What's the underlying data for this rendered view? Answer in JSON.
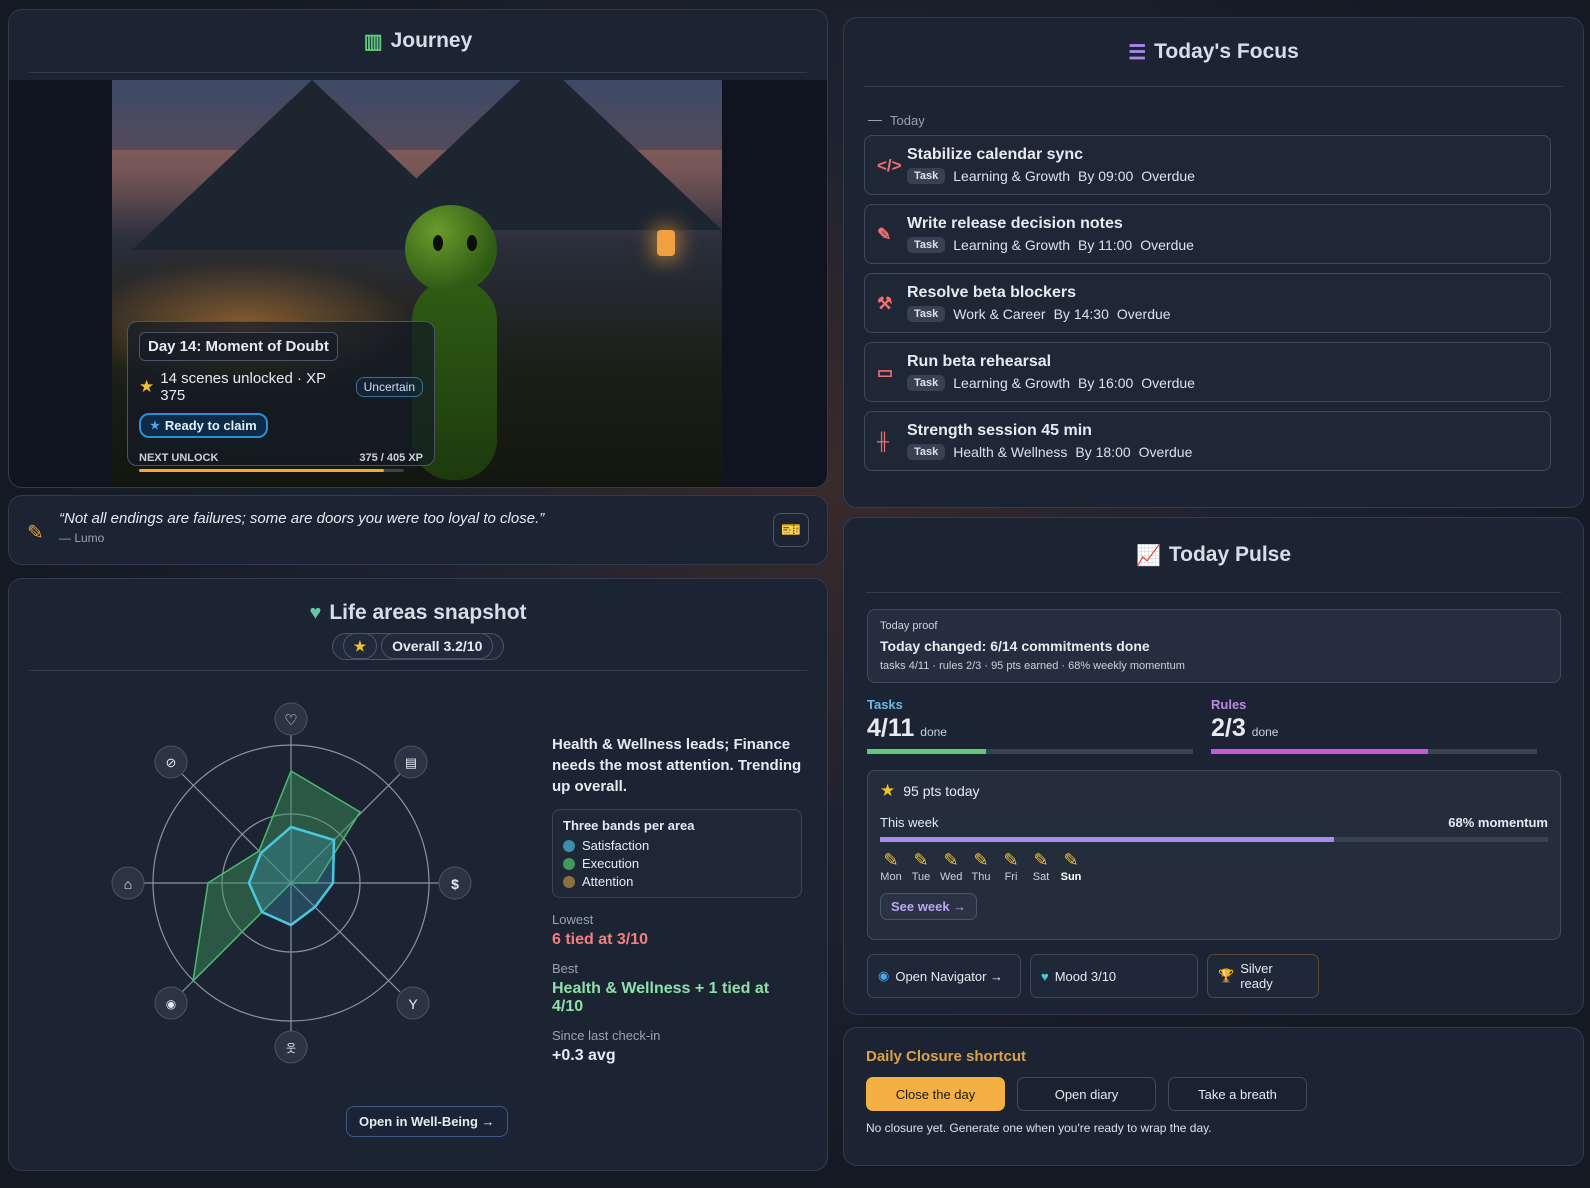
{
  "journey": {
    "title": "Journey",
    "day_title": "Day 14: Moment of Doubt",
    "scenes_text": "14 scenes unlocked · XP 375",
    "mood_badge": "Uncertain",
    "claim_label": "Ready to claim",
    "next_unlock_label": "NEXT UNLOCK",
    "xp_progress": "375 / 405 XP",
    "xp_current": 375,
    "xp_target": 405
  },
  "quote": {
    "text": "“Not all endings are failures; some are doors you were too loyal to close.”",
    "author": "— Lumo"
  },
  "life": {
    "title": "Life areas snapshot",
    "overall": "Overall 3.2/10",
    "lead_text": "Health & Wellness leads; Finance needs the most attention. Trending up overall.",
    "bands_title": "Three bands per area",
    "bands": [
      "Satisfaction",
      "Execution",
      "Attention"
    ],
    "band_colors": [
      "#3a8fa8",
      "#3f9a5c",
      "#8a7040"
    ],
    "lowest_label": "Lowest",
    "lowest_value": "6 tied at 3/10",
    "best_label": "Best",
    "best_value": "Health & Wellness + 1 tied at 4/10",
    "since_label": "Since last check-in",
    "since_value": "+0.3 avg",
    "open_button": "Open in Well-Being →",
    "areas": [
      {
        "icon": "heart-icon"
      },
      {
        "icon": "briefcase-icon"
      },
      {
        "icon": "dollar-icon"
      },
      {
        "icon": "cocktail-icon"
      },
      {
        "icon": "people-icon"
      },
      {
        "icon": "robot-icon"
      },
      {
        "icon": "home-icon"
      },
      {
        "icon": "compass-icon"
      }
    ]
  },
  "focus": {
    "title": "Today's Focus",
    "section_label": "Today",
    "tasks": [
      {
        "name": "Stabilize calendar sync",
        "tag": "Task",
        "area": "Learning & Growth",
        "due": "By 09:00",
        "status": "Overdue",
        "icon": "code-icon"
      },
      {
        "name": "Write release decision notes",
        "tag": "Task",
        "area": "Learning & Growth",
        "due": "By 11:00",
        "status": "Overdue",
        "icon": "edit-icon"
      },
      {
        "name": "Resolve beta blockers",
        "tag": "Task",
        "area": "Work & Career",
        "due": "By 14:30",
        "status": "Overdue",
        "icon": "wrench-icon"
      },
      {
        "name": "Run beta rehearsal",
        "tag": "Task",
        "area": "Learning & Growth",
        "due": "By 16:00",
        "status": "Overdue",
        "icon": "presentation-icon"
      },
      {
        "name": "Strength session 45 min",
        "tag": "Task",
        "area": "Health & Wellness",
        "due": "By 18:00",
        "status": "Overdue",
        "icon": "dumbbell-icon"
      }
    ]
  },
  "pulse": {
    "title": "Today Pulse",
    "proof_label": "Today proof",
    "proof_title": "Today changed: 6/14 commitments done",
    "proof_sub": "tasks 4/11 · rules 2/3 · 95 pts earned · 68% weekly momentum",
    "tasks_label": "Tasks",
    "tasks_value": "4/11",
    "tasks_done": "done",
    "tasks_fraction": 0.364,
    "rules_label": "Rules",
    "rules_value": "2/3",
    "rules_done": "done",
    "rules_fraction": 0.667,
    "pts_today": "95 pts today",
    "this_week": "This week",
    "momentum": "68% momentum",
    "momentum_fraction": 0.68,
    "days": [
      "Mon",
      "Tue",
      "Wed",
      "Thu",
      "Fri",
      "Sat",
      "Sun"
    ],
    "see_week": "See week →",
    "chip_navigator": "Open Navigator →",
    "chip_mood": "Mood 3/10",
    "chip_silver": "Silver ready"
  },
  "closure": {
    "title": "Daily Closure shortcut",
    "close_day": "Close the day",
    "open_diary": "Open diary",
    "take_breath": "Take a breath",
    "note": "No closure yet. Generate one when you're ready to wrap the day."
  },
  "colors": {
    "tasks_accent": "#5fc87a",
    "rules_accent": "#c65ad8",
    "tasks_label": "#6ab8e8",
    "rules_label": "#b98ae0",
    "lowest": "#f08080",
    "best": "#8ee0a8"
  }
}
